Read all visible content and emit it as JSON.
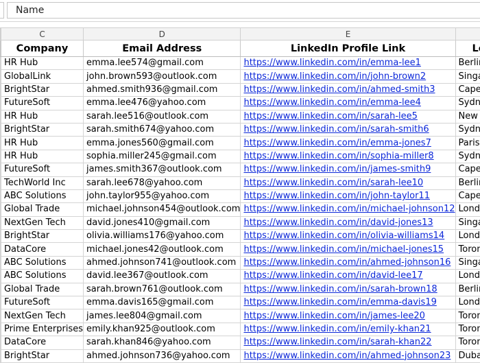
{
  "formula_bar": {
    "value": "Name"
  },
  "column_letters": [
    "C",
    "D",
    "E",
    ""
  ],
  "headers": [
    "Company",
    "Email Address",
    "LinkedIn Profile Link",
    "Lo"
  ],
  "rows": [
    [
      "HR Hub",
      "emma.lee574@gmail.com",
      "https://www.linkedin.com/in/emma-lee1",
      "Berlin"
    ],
    [
      "GlobalLink",
      "john.brown593@outlook.com",
      "https://www.linkedin.com/in/john-brown2",
      "Singap"
    ],
    [
      "BrightStar",
      "ahmed.smith936@gmail.com",
      "https://www.linkedin.com/in/ahmed-smith3",
      "Cape"
    ],
    [
      "FutureSoft",
      "emma.lee476@yahoo.com",
      "https://www.linkedin.com/in/emma-lee4",
      "Sydne"
    ],
    [
      "HR Hub",
      "sarah.lee516@outlook.com",
      "https://www.linkedin.com/in/sarah-lee5",
      "New Y"
    ],
    [
      "BrightStar",
      "sarah.smith674@yahoo.com",
      "https://www.linkedin.com/in/sarah-smith6",
      "Sydne"
    ],
    [
      "HR Hub",
      "emma.jones560@gmail.com",
      "https://www.linkedin.com/in/emma-jones7",
      "Paris,"
    ],
    [
      "HR Hub",
      "sophia.miller245@gmail.com",
      "https://www.linkedin.com/in/sophia-miller8",
      "Sydne"
    ],
    [
      "FutureSoft",
      "james.smith367@outlook.com",
      "https://www.linkedin.com/in/james-smith9",
      "Cape"
    ],
    [
      "TechWorld Inc",
      "sarah.lee678@yahoo.com",
      "https://www.linkedin.com/in/sarah-lee10",
      "Berlin"
    ],
    [
      "ABC Solutions",
      "john.taylor955@yahoo.com",
      "https://www.linkedin.com/in/john-taylor11",
      "Cape"
    ],
    [
      "Global Trade",
      "michael.johnson454@outlook.com",
      "https://www.linkedin.com/in/michael-johnson12",
      "Londo"
    ],
    [
      "NextGen Tech",
      "david.jones410@gmail.com",
      "https://www.linkedin.com/in/david-jones13",
      "Singap"
    ],
    [
      "BrightStar",
      "olivia.williams176@yahoo.com",
      "https://www.linkedin.com/in/olivia-williams14",
      "Londo"
    ],
    [
      "DataCore",
      "michael.jones42@outlook.com",
      "https://www.linkedin.com/in/michael-jones15",
      "Toron"
    ],
    [
      "ABC Solutions",
      "ahmed.johnson741@outlook.com",
      "https://www.linkedin.com/in/ahmed-johnson16",
      "Singap"
    ],
    [
      "ABC Solutions",
      "david.lee367@outlook.com",
      "https://www.linkedin.com/in/david-lee17",
      "Londo"
    ],
    [
      "Global Trade",
      "sarah.brown761@outlook.com",
      "https://www.linkedin.com/in/sarah-brown18",
      "Berlin"
    ],
    [
      "FutureSoft",
      "emma.davis165@gmail.com",
      "https://www.linkedin.com/in/emma-davis19",
      "Londo"
    ],
    [
      "NextGen Tech",
      "james.lee804@gmail.com",
      "https://www.linkedin.com/in/james-lee20",
      "Toron"
    ],
    [
      "Prime Enterprises",
      "emily.khan925@outlook.com",
      "https://www.linkedin.com/in/emily-khan21",
      "Toron"
    ],
    [
      "DataCore",
      "sarah.khan846@yahoo.com",
      "https://www.linkedin.com/in/sarah-khan22",
      "Toron"
    ],
    [
      "BrightStar",
      "ahmed.johnson736@yahoo.com",
      "https://www.linkedin.com/in/ahmed-johnson23",
      "Dubai"
    ]
  ]
}
